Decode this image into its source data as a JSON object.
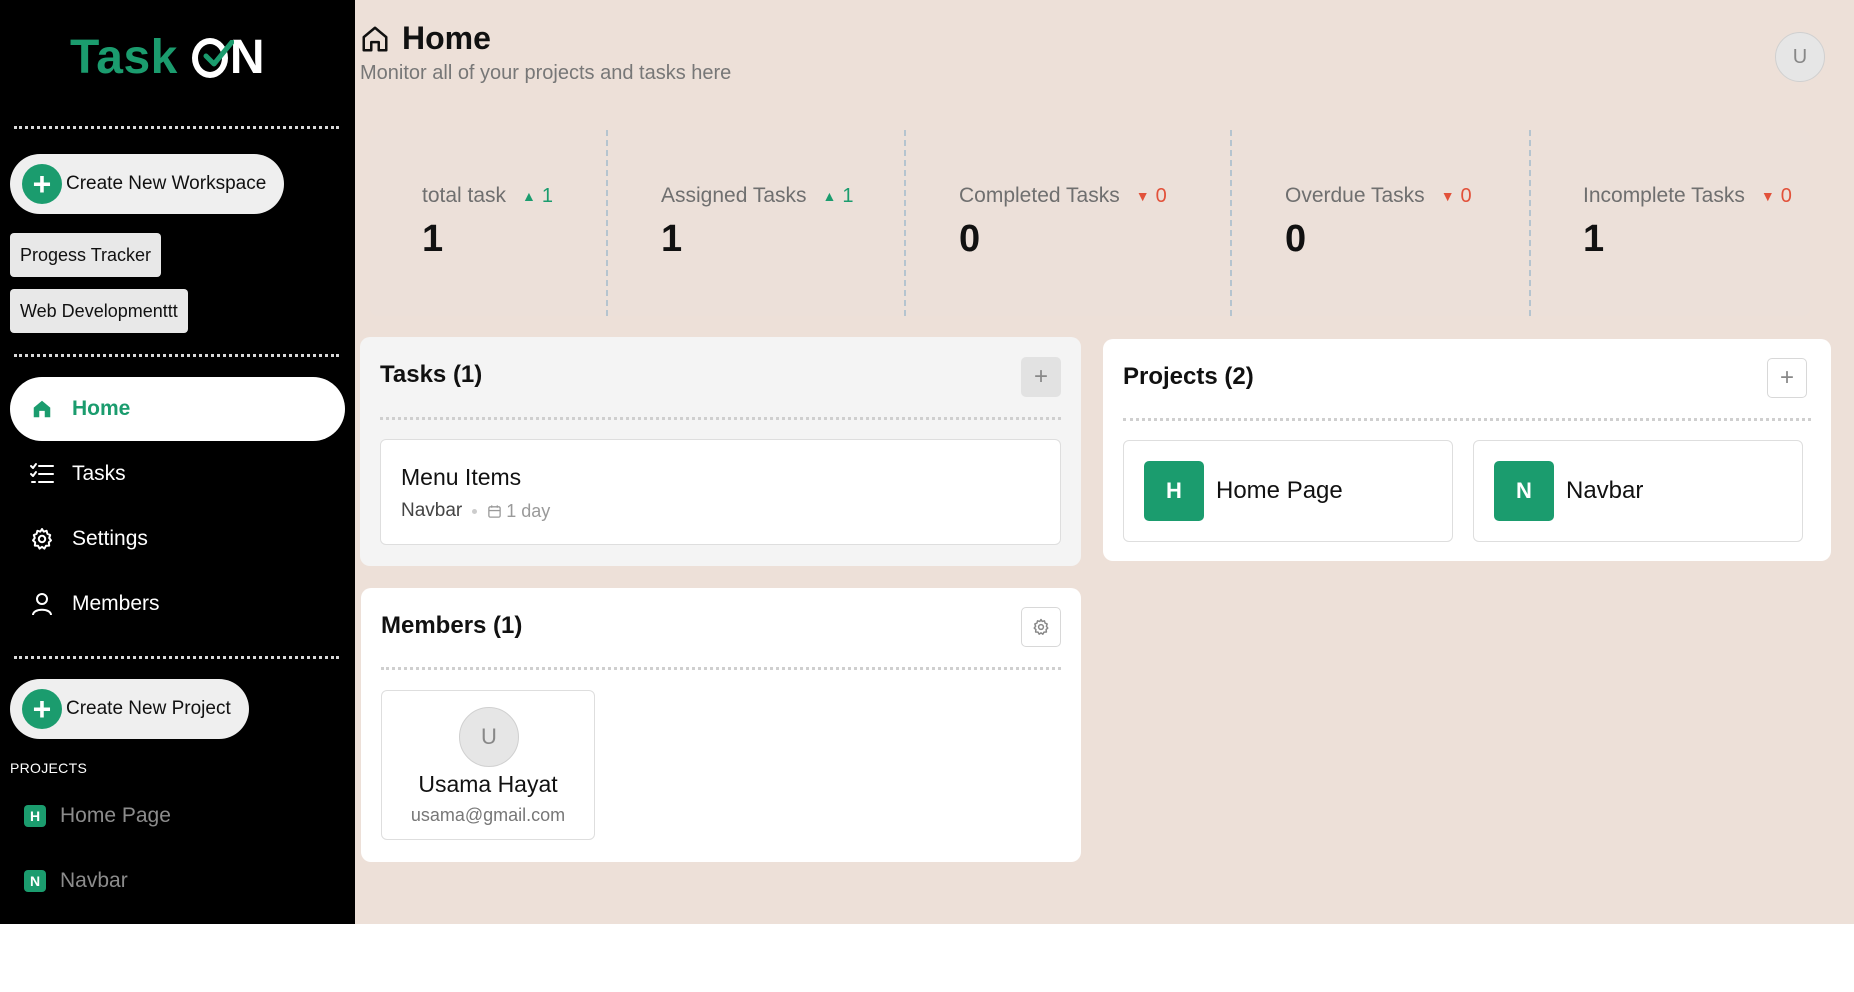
{
  "logo": {
    "part1": "Task",
    "part2": "N"
  },
  "sidebar": {
    "create_workspace": "Create New Workspace",
    "workspaces": [
      "Progess Tracker",
      "Web Developmenttt"
    ],
    "nav": [
      {
        "label": "Home",
        "icon": "home-icon",
        "active": true
      },
      {
        "label": "Tasks",
        "icon": "list-icon"
      },
      {
        "label": "Settings",
        "icon": "gear-icon"
      },
      {
        "label": "Members",
        "icon": "user-icon"
      }
    ],
    "create_project": "Create New Project",
    "projects_heading": "PROJECTS",
    "projects": [
      {
        "initial": "H",
        "name": "Home Page"
      },
      {
        "initial": "N",
        "name": "Navbar"
      }
    ]
  },
  "header": {
    "title": "Home",
    "subtitle": "Monitor all of your projects and tasks here",
    "avatar_initial": "U"
  },
  "stats": [
    {
      "label": "total task",
      "value": "1",
      "trend": "up",
      "trend_value": "1"
    },
    {
      "label": "Assigned Tasks",
      "value": "1",
      "trend": "up",
      "trend_value": "1"
    },
    {
      "label": "Completed Tasks",
      "value": "0",
      "trend": "down",
      "trend_value": "0"
    },
    {
      "label": "Overdue Tasks",
      "value": "0",
      "trend": "down",
      "trend_value": "0"
    },
    {
      "label": "Incomplete Tasks",
      "value": "1",
      "trend": "down",
      "trend_value": "0"
    }
  ],
  "tasks_card": {
    "title": "Tasks (1)",
    "items": [
      {
        "name": "Menu Items",
        "project": "Navbar",
        "due": "1 day"
      }
    ]
  },
  "projects_card": {
    "title": "Projects (2)",
    "items": [
      {
        "initial": "H",
        "name": "Home Page"
      },
      {
        "initial": "N",
        "name": "Navbar"
      }
    ]
  },
  "members_card": {
    "title": "Members (1)",
    "items": [
      {
        "initial": "U",
        "name": "Usama Hayat",
        "email": "usama@gmail.com"
      }
    ]
  },
  "colors": {
    "accent": "#1b9c6e",
    "down": "#e2513a",
    "main_bg": "#ede0d8",
    "sidebar_bg": "#000000"
  }
}
